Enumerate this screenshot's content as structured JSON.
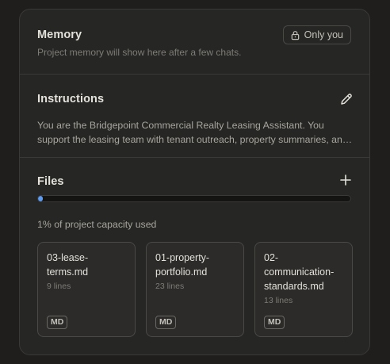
{
  "memory": {
    "title": "Memory",
    "subtitle": "Project memory will show here after a few chats.",
    "visibility_label": "Only you",
    "visibility_icon": "lock-icon"
  },
  "instructions": {
    "title": "Instructions",
    "text": "You are the Bridgepoint Commercial Realty Leasing Assistant. You support the leasing team with tenant outreach, property summaries, and more.",
    "edit_icon": "pencil-icon"
  },
  "files": {
    "title": "Files",
    "add_icon": "plus-icon",
    "capacity_percent": 1,
    "capacity_label": "1% of project capacity used",
    "accent_color": "#5d9cf0",
    "items": [
      {
        "name": "03-lease-terms.md",
        "lines": "9 lines",
        "type": "MD"
      },
      {
        "name": "01-property-portfolio.md",
        "lines": "23 lines",
        "type": "MD"
      },
      {
        "name": "02-communication-standards.md",
        "lines": "13 lines",
        "type": "MD"
      }
    ]
  }
}
